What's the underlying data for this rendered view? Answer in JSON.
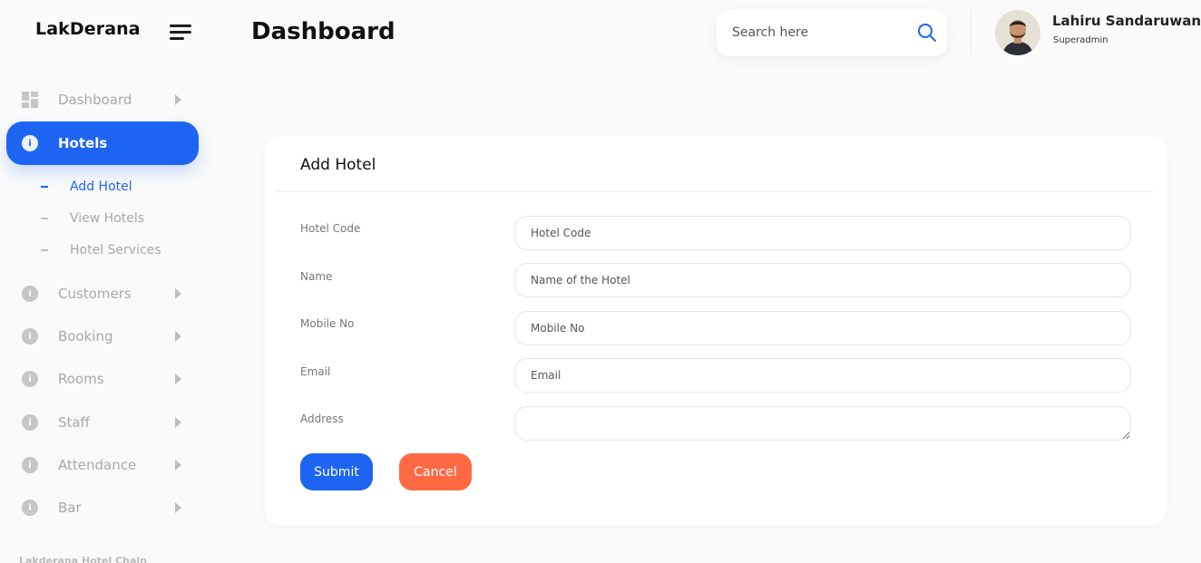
{
  "brand": "LakDerana",
  "header": {
    "title": "Dashboard",
    "search_placeholder": "Search here",
    "user_name": "Lahiru Sandaruwan",
    "user_role": "Superadmin"
  },
  "sidebar": {
    "items": [
      {
        "label": "Dashboard",
        "icon": "dashboard-grid-icon"
      },
      {
        "label": "Hotels",
        "icon": "info-icon",
        "active": true
      },
      {
        "label": "Customers",
        "icon": "info-icon"
      },
      {
        "label": "Booking",
        "icon": "info-icon"
      },
      {
        "label": "Rooms",
        "icon": "info-icon"
      },
      {
        "label": "Staff",
        "icon": "info-icon"
      },
      {
        "label": "Attendance",
        "icon": "info-icon"
      },
      {
        "label": "Bar",
        "icon": "info-icon"
      }
    ],
    "hotel_submenu": [
      {
        "label": "Add Hotel",
        "active": true
      },
      {
        "label": "View Hotels"
      },
      {
        "label": "Hotel Services"
      }
    ],
    "icon_glyph": "i",
    "footer": "Lakderana Hotel Chain"
  },
  "form": {
    "title": "Add Hotel",
    "fields": [
      {
        "label": "Hotel Code",
        "placeholder": "Hotel Code"
      },
      {
        "label": "Name",
        "placeholder": "Name of the Hotel"
      },
      {
        "label": "Mobile No",
        "placeholder": "Mobile No"
      },
      {
        "label": "Email",
        "placeholder": "Email"
      },
      {
        "label": "Address",
        "placeholder": ""
      }
    ],
    "submit_label": "Submit",
    "cancel_label": "Cancel"
  },
  "colors": {
    "accent": "#1d64f2",
    "cancel": "#ff6a45",
    "background": "#fafafa"
  }
}
